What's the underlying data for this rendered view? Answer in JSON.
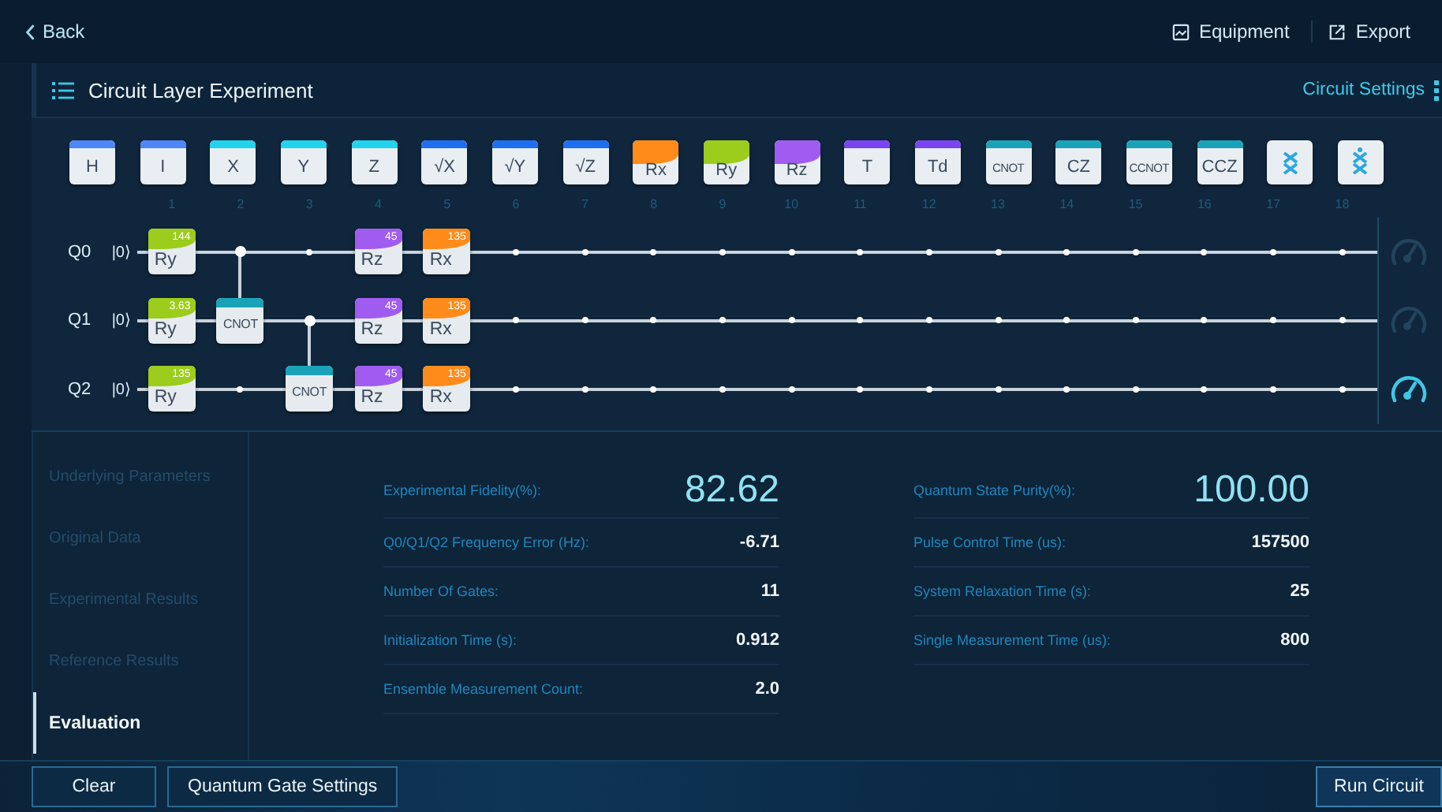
{
  "top_bar": {
    "back": "Back",
    "actions": [
      {
        "label": "Equipment",
        "kind": "equipment"
      },
      {
        "label": "Export",
        "kind": "export"
      }
    ]
  },
  "title_bar": {
    "title": "Circuit Layer Experiment",
    "settings": "Circuit Settings"
  },
  "palette": [
    {
      "label": "H",
      "kind": "plain",
      "color": "#4f86f5"
    },
    {
      "label": "I",
      "kind": "plain",
      "color": "#4f86f5"
    },
    {
      "label": "X",
      "kind": "plain",
      "color": "#22d3ee"
    },
    {
      "label": "Y",
      "kind": "plain",
      "color": "#22d3ee"
    },
    {
      "label": "Z",
      "kind": "plain",
      "color": "#22d3ee"
    },
    {
      "label": "√X",
      "kind": "plain",
      "color": "#1e6ff0"
    },
    {
      "label": "√Y",
      "kind": "plain",
      "color": "#1e6ff0"
    },
    {
      "label": "√Z",
      "kind": "plain",
      "color": "#1e6ff0"
    },
    {
      "label": "Rx",
      "kind": "rotation",
      "color": "#ff8c1a"
    },
    {
      "label": "Ry",
      "kind": "rotation",
      "color": "#9ccc1c"
    },
    {
      "label": "Rz",
      "kind": "rotation",
      "color": "#a05cf0"
    },
    {
      "label": "T",
      "kind": "plain",
      "color": "#7a45f0"
    },
    {
      "label": "Td",
      "kind": "plain",
      "color": "#7a45f0"
    },
    {
      "label": "CNOT",
      "kind": "plain",
      "color": "#1aa3b8"
    },
    {
      "label": "CZ",
      "kind": "plain",
      "color": "#1aa3b8"
    },
    {
      "label": "CCNOT",
      "kind": "plain",
      "color": "#1aa3b8"
    },
    {
      "label": "CCZ",
      "kind": "plain",
      "color": "#1aa3b8"
    },
    {
      "kind": "swap"
    },
    {
      "kind": "swap-control"
    }
  ],
  "columns": [
    "1",
    "2",
    "3",
    "4",
    "5",
    "6",
    "7",
    "8",
    "9",
    "10",
    "11",
    "12",
    "13",
    "14",
    "15",
    "16",
    "17",
    "18"
  ],
  "qubits": [
    {
      "label": "Q0",
      "state": "|0⟩",
      "measured": false,
      "cells": [
        {
          "kind": "gate",
          "name": "Ry",
          "param": "144",
          "color": "#9ccc1c"
        },
        {
          "kind": "control"
        },
        {
          "kind": "empty"
        },
        {
          "kind": "gate",
          "name": "Rz",
          "param": "45",
          "color": "#a05cf0"
        },
        {
          "kind": "gate",
          "name": "Rx",
          "param": "135",
          "color": "#ff8c1a"
        },
        {
          "kind": "empty"
        },
        {
          "kind": "empty"
        },
        {
          "kind": "empty"
        },
        {
          "kind": "empty"
        },
        {
          "kind": "empty"
        },
        {
          "kind": "empty"
        },
        {
          "kind": "empty"
        },
        {
          "kind": "empty"
        },
        {
          "kind": "empty"
        },
        {
          "kind": "empty"
        },
        {
          "kind": "empty"
        },
        {
          "kind": "empty"
        },
        {
          "kind": "empty"
        }
      ]
    },
    {
      "label": "Q1",
      "state": "|0⟩",
      "measured": false,
      "cells": [
        {
          "kind": "gate",
          "name": "Ry",
          "param": "3.63",
          "color": "#9ccc1c"
        },
        {
          "kind": "multi",
          "name": "CNOT",
          "color": "#1aa3b8"
        },
        {
          "kind": "control"
        },
        {
          "kind": "gate",
          "name": "Rz",
          "param": "45",
          "color": "#a05cf0"
        },
        {
          "kind": "gate",
          "name": "Rx",
          "param": "135",
          "color": "#ff8c1a"
        },
        {
          "kind": "empty"
        },
        {
          "kind": "empty"
        },
        {
          "kind": "empty"
        },
        {
          "kind": "empty"
        },
        {
          "kind": "empty"
        },
        {
          "kind": "empty"
        },
        {
          "kind": "empty"
        },
        {
          "kind": "empty"
        },
        {
          "kind": "empty"
        },
        {
          "kind": "empty"
        },
        {
          "kind": "empty"
        },
        {
          "kind": "empty"
        },
        {
          "kind": "empty"
        }
      ]
    },
    {
      "label": "Q2",
      "state": "|0⟩",
      "measured": true,
      "cells": [
        {
          "kind": "gate",
          "name": "Ry",
          "param": "135",
          "color": "#9ccc1c"
        },
        {
          "kind": "empty"
        },
        {
          "kind": "multi",
          "name": "CNOT",
          "color": "#1aa3b8"
        },
        {
          "kind": "gate",
          "name": "Rz",
          "param": "45",
          "color": "#a05cf0"
        },
        {
          "kind": "gate",
          "name": "Rx",
          "param": "135",
          "color": "#ff8c1a"
        },
        {
          "kind": "empty"
        },
        {
          "kind": "empty"
        },
        {
          "kind": "empty"
        },
        {
          "kind": "empty"
        },
        {
          "kind": "empty"
        },
        {
          "kind": "empty"
        },
        {
          "kind": "empty"
        },
        {
          "kind": "empty"
        },
        {
          "kind": "empty"
        },
        {
          "kind": "empty"
        },
        {
          "kind": "empty"
        },
        {
          "kind": "empty"
        },
        {
          "kind": "empty"
        }
      ]
    }
  ],
  "sidebar": {
    "items": [
      {
        "label": "Underlying Parameters",
        "selected": false
      },
      {
        "label": "Original Data",
        "selected": false
      },
      {
        "label": "Experimental Results",
        "selected": false
      },
      {
        "label": "Reference Results",
        "selected": false
      },
      {
        "label": "Evaluation",
        "selected": true
      }
    ]
  },
  "metrics": [
    [
      {
        "label": "Experimental Fidelity(%):",
        "value": "82.62",
        "kind": "headline"
      },
      {
        "label": "Q0/Q1/Q2 Frequency Error (Hz):",
        "value": "-6.71",
        "kind": "row"
      },
      {
        "label": "Number Of Gates:",
        "value": "11",
        "kind": "row"
      },
      {
        "label": "Initialization Time (s):",
        "value": "0.912",
        "kind": "row"
      },
      {
        "label": "Ensemble Measurement Count:",
        "value": "2.0",
        "kind": "row"
      }
    ],
    [
      {
        "label": "Quantum State Purity(%):",
        "value": "100.00",
        "kind": "headline"
      },
      {
        "label": "Pulse Control Time (us):",
        "value": "157500",
        "kind": "row"
      },
      {
        "label": "System Relaxation Time (s):",
        "value": "25",
        "kind": "row"
      },
      {
        "label": "Single Measurement Time (us):",
        "value": "800",
        "kind": "row"
      }
    ]
  ],
  "bottom_bar": {
    "left_buttons": [
      "Clear",
      "Quantum Gate Settings"
    ],
    "right_button": "Run Circuit"
  }
}
